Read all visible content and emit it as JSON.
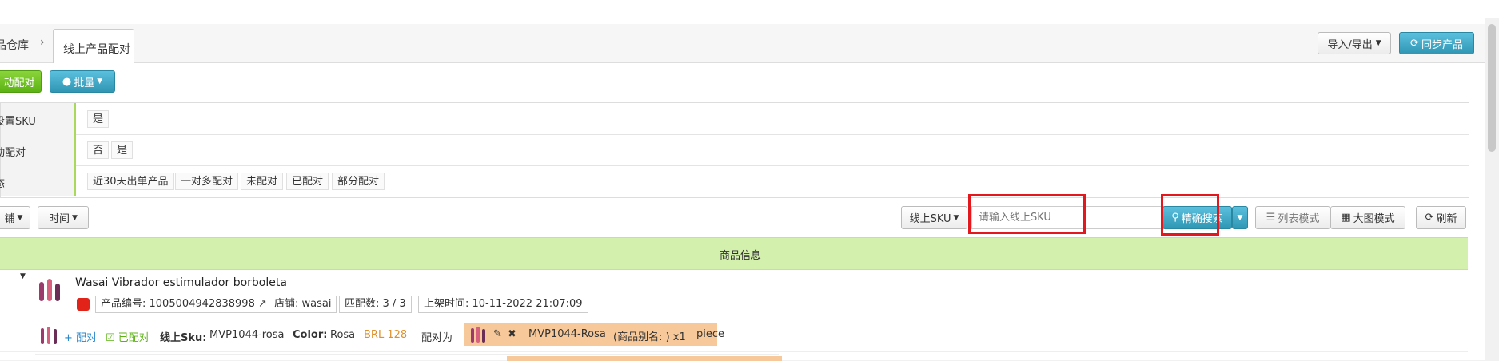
{
  "breadcrumb": {
    "parent": "品仓库",
    "separator": "›",
    "current_tab": "线上产品配对"
  },
  "header_actions": {
    "import_export": "导入/导出",
    "sync": "同步产品"
  },
  "actions": {
    "auto_match": "动配对",
    "batch": "批量"
  },
  "filters": [
    {
      "label": "设置SKU",
      "options": [
        "是"
      ]
    },
    {
      "label": "动配对",
      "options": [
        "否",
        "是"
      ]
    },
    {
      "label": "态",
      "options": [
        "近30天出单产品",
        "一对多配对",
        "未配对",
        "已配对",
        "部分配对"
      ]
    }
  ],
  "toolbar": {
    "store_dropdown": "铺",
    "time_dropdown": "时间",
    "search_field_select": "线上SKU",
    "search_placeholder": "请输入线上SKU",
    "search_button": "精确搜索",
    "list_mode": "列表模式",
    "grid_mode": "大图模式",
    "refresh": "刷新"
  },
  "table": {
    "header": "商品信息"
  },
  "product": {
    "title": "Wasai Vibrador estimulador borboleta",
    "product_id": "产品编号: 1005004942838998",
    "store": "店铺: wasai",
    "match_count": "匹配数: 3 / 3",
    "listed_time": "上架时间: 10-11-2022 21:07:09"
  },
  "variant": {
    "add_match": "+ 配对",
    "matched": "已配对",
    "sku_label": "线上Sku:",
    "sku_value": "MVP1044-rosa",
    "color_label": "Color:",
    "color_value": "Rosa",
    "price": "BRL 128",
    "match_as": "配对为",
    "matched_sku": "MVP1044-Rosa",
    "alias": "(商品别名: ) x1",
    "unit": "piece"
  },
  "colors": {
    "accent_green": "#a8d95a",
    "highlight_red": "#e3181f",
    "match_orange": "#f7c99a"
  }
}
